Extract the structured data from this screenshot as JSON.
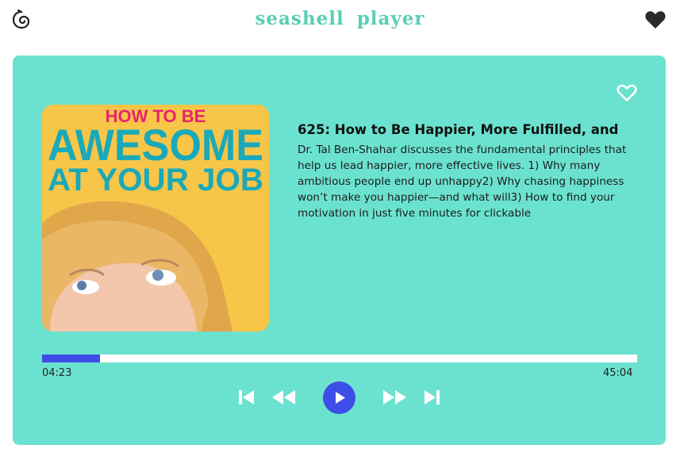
{
  "app": {
    "title_word1": "seashell",
    "title_word2": "player"
  },
  "icons": {
    "logo": "seashell-spiral-icon",
    "favorite_top": "heart-filled-icon",
    "favorite_card": "heart-outline-icon",
    "skip_start": "skip-to-start-icon",
    "rewind": "rewind-icon",
    "play": "play-icon",
    "fast_forward": "fast-forward-icon",
    "skip_end": "skip-to-end-icon"
  },
  "cover": {
    "line1": "HOW TO BE",
    "line2": "AWESOME",
    "line3": "AT YOUR JOB"
  },
  "episode": {
    "title": "625: How to Be Happier, More Fulfilled, and",
    "description": "Dr. Tal Ben-Shahar discusses the fundamental principles that help us lead happier, more effective lives. 1) Why many ambitious people end up unhappy2) Why chasing happiness won’t make you happier—and what will3) How to find your motivation in just five minutes  for clickable"
  },
  "player": {
    "current_time": "04:23",
    "duration": "45:04",
    "progress": 0.097
  },
  "colors": {
    "card": "#6be2cf",
    "accent": "#3d4de8",
    "title": "#59cfb5"
  }
}
